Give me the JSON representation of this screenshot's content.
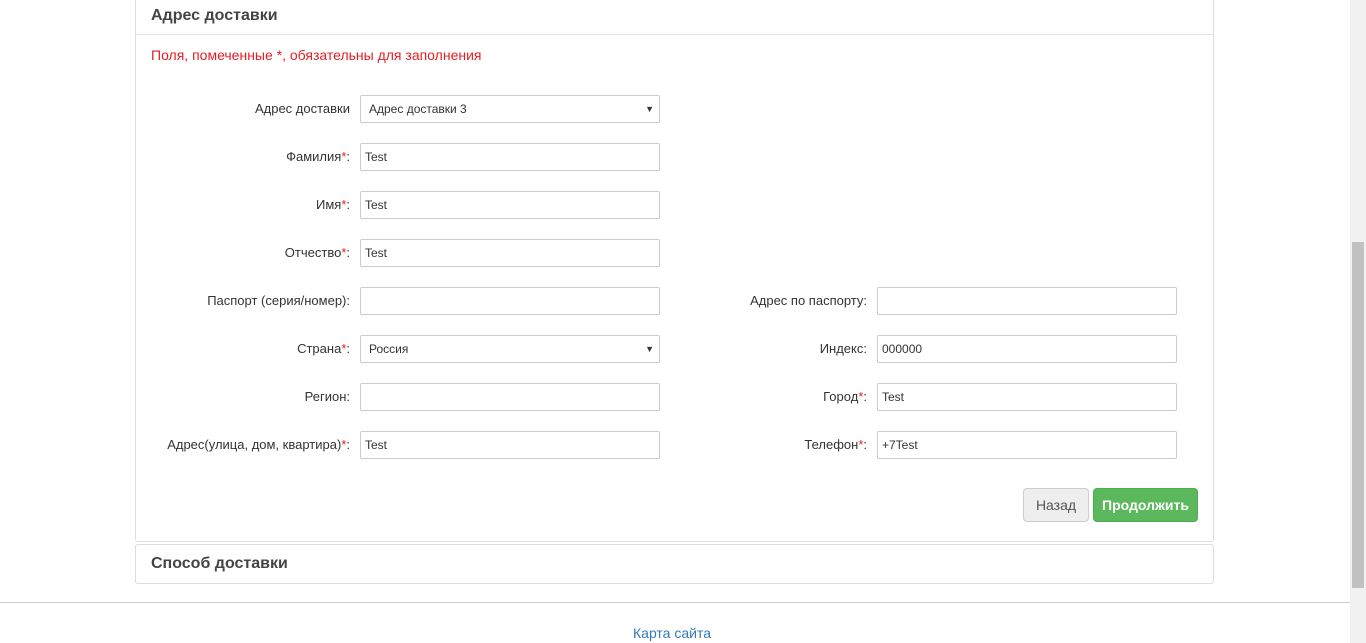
{
  "address_panel": {
    "title": "Адрес доставки",
    "required_note": "Поля, помеченные *, обязательны для заполнения",
    "fields": {
      "delivery_address": {
        "label": "Адрес доставки",
        "value": "Адрес доставки 3"
      },
      "last_name": {
        "label": "Фамилия",
        "star": "*",
        "suffix": ":",
        "value": "Test"
      },
      "first_name": {
        "label": "Имя",
        "star": "*",
        "suffix": ":",
        "value": "Test"
      },
      "middle_name": {
        "label": "Отчество",
        "star": "*",
        "suffix": ":",
        "value": "Test"
      },
      "passport": {
        "label": "Паспорт (серия/номер):",
        "value": ""
      },
      "passport_address": {
        "label": "Адрес по паспорту:",
        "value": ""
      },
      "country": {
        "label": "Страна",
        "star": "*",
        "suffix": ":",
        "value": "Россия"
      },
      "postcode": {
        "label": "Индекс:",
        "value": "000000"
      },
      "region": {
        "label": "Регион:",
        "value": ""
      },
      "city": {
        "label": "Город",
        "star": "*",
        "suffix": ":",
        "value": "Test"
      },
      "street_address": {
        "label": "Адрес(улица, дом, квартира)",
        "star": "*",
        "suffix": ":",
        "value": "Test"
      },
      "phone": {
        "label": "Телефон",
        "star": "*",
        "suffix": ":",
        "value": "+7Test"
      }
    },
    "select_arrow": "▼",
    "buttons": {
      "back": "Назад",
      "continue": "Продолжить"
    }
  },
  "delivery_method_panel": {
    "title": "Способ доставки"
  },
  "footer": {
    "sitemap_link": "Карта сайта"
  },
  "colors": {
    "required": "#e31e24",
    "primary_button": "#5cb85c",
    "link": "#337ab7"
  }
}
